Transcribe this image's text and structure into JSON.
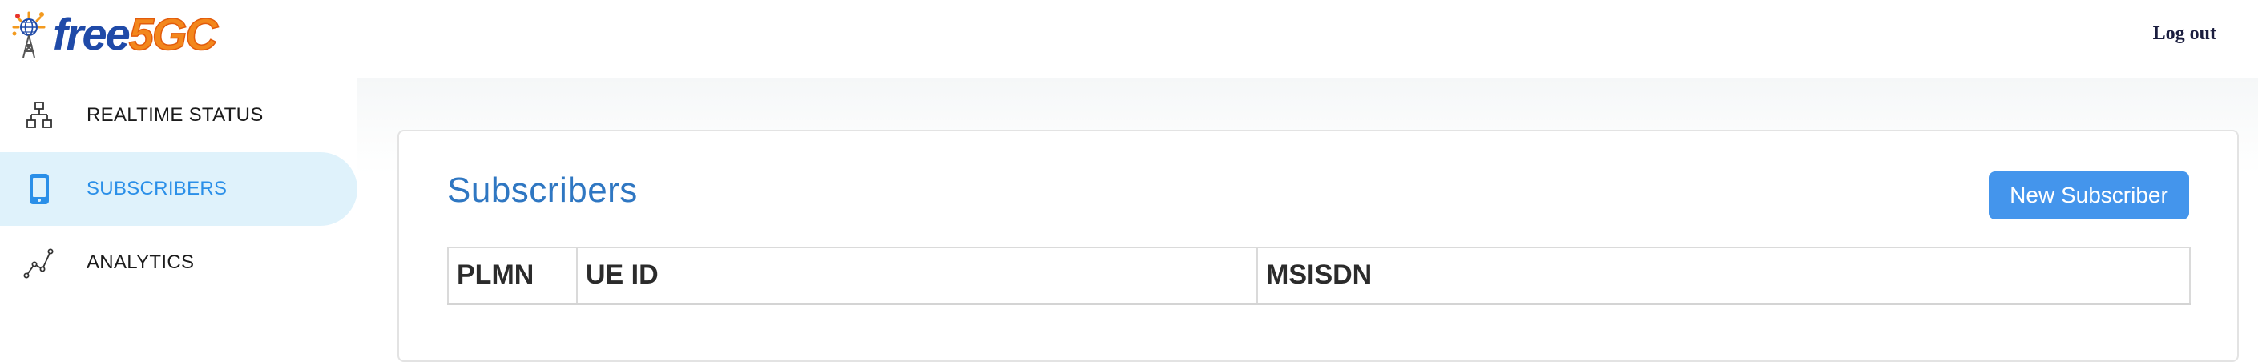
{
  "header": {
    "logo_text_free": "free",
    "logo_text_5gc": "5GC",
    "logout_label": "Log out",
    "colors": {
      "logo_blue": "#1f4aa8",
      "logo_orange": "#f3871c"
    }
  },
  "sidebar": {
    "items": [
      {
        "label": "REALTIME STATUS",
        "icon": "network-nodes-icon",
        "active": false
      },
      {
        "label": "SUBSCRIBERS",
        "icon": "smartphone-icon",
        "active": true
      },
      {
        "label": "ANALYTICS",
        "icon": "line-chart-icon",
        "active": false
      }
    ],
    "active_color": "#2a8fe8",
    "active_bg": "#dff2fb"
  },
  "main": {
    "title": "Subscribers",
    "new_button_label": "New Subscriber",
    "accent": "#4495ec",
    "table": {
      "columns": [
        "PLMN",
        "UE ID",
        "MSISDN"
      ],
      "rows": []
    }
  }
}
